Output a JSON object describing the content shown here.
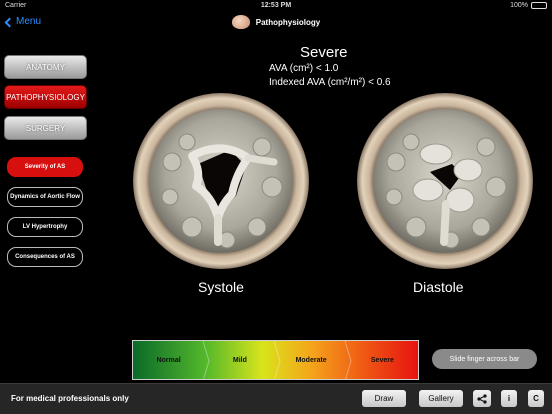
{
  "status_bar": {
    "carrier": "Carrier",
    "time": "12:53 PM",
    "battery": "100%"
  },
  "nav": {
    "back_label": "Menu",
    "title": "Pathophysiology"
  },
  "left_nav": {
    "main": [
      {
        "label": "ANATOMY",
        "active": false
      },
      {
        "label": "PATHOPHYSIOLOGY",
        "active": true
      },
      {
        "label": "SURGERY",
        "active": false
      }
    ],
    "sub": [
      {
        "label": "Severity of AS",
        "active": true
      },
      {
        "label": "Dynamics of Aortic Flow",
        "active": false
      },
      {
        "label": "LV Hypertrophy",
        "active": false
      },
      {
        "label": "Consequences of AS",
        "active": false
      }
    ]
  },
  "content": {
    "severity": "Severe",
    "ava": "AVA (cm²) < 1.0",
    "indexed_ava": "Indexed AVA (cm²/m²) < 0.6",
    "systole_label": "Systole",
    "diastole_label": "Diastole"
  },
  "severity_bar": {
    "segments": [
      "Normal",
      "Mild",
      "Moderate",
      "Severe"
    ],
    "selected": "Severe",
    "hint": "Slide finger across bar"
  },
  "toolbar": {
    "disclaimer": "For medical professionals only",
    "draw": "Draw",
    "gallery": "Gallery",
    "info": "i",
    "copyright": "C"
  }
}
